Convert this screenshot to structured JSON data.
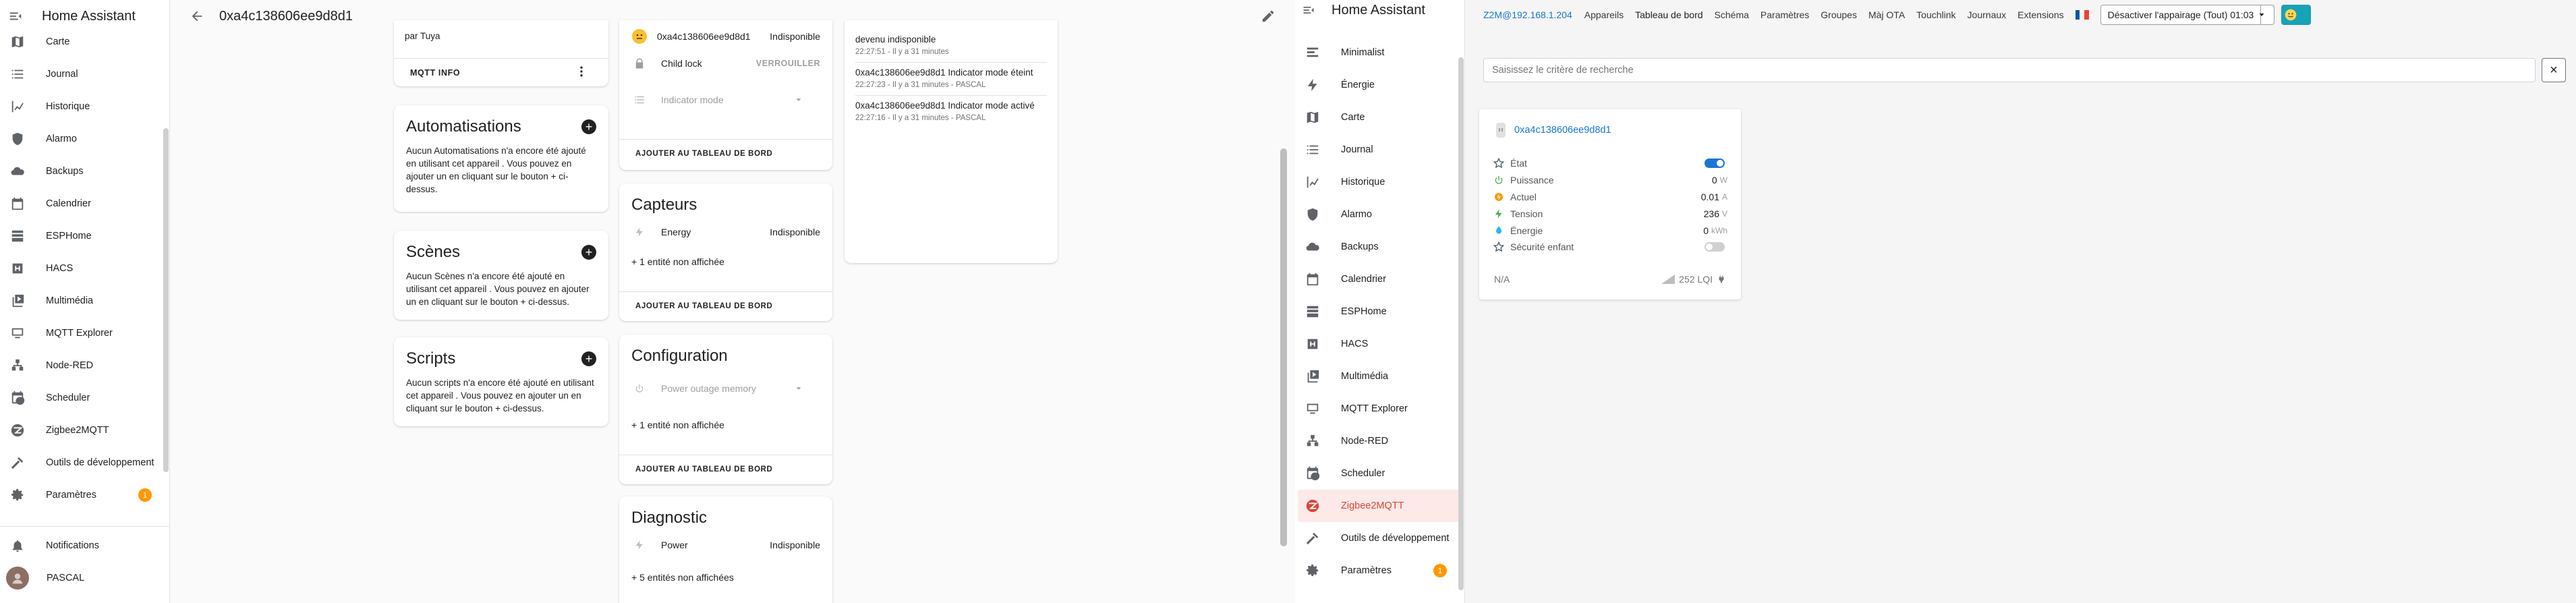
{
  "left": {
    "sidebar": {
      "title": "Home Assistant",
      "items": [
        {
          "label": "Carte",
          "icon": "map-icon"
        },
        {
          "label": "Journal",
          "icon": "journal-icon"
        },
        {
          "label": "Historique",
          "icon": "chart-icon"
        },
        {
          "label": "Alarmo",
          "icon": "shield-icon"
        },
        {
          "label": "Backups",
          "icon": "cloud-icon"
        },
        {
          "label": "Calendrier",
          "icon": "calendar-icon"
        },
        {
          "label": "ESPHome",
          "icon": "esphome-icon"
        },
        {
          "label": "HACS",
          "icon": "hacs-icon"
        },
        {
          "label": "Multimédia",
          "icon": "media-icon"
        },
        {
          "label": "MQTT Explorer",
          "icon": "mqtt-icon"
        },
        {
          "label": "Node-RED",
          "icon": "sitemap-icon"
        },
        {
          "label": "Scheduler",
          "icon": "calendar-clock-icon"
        },
        {
          "label": "Zigbee2MQTT",
          "icon": "zigbee-icon"
        },
        {
          "label": "Outils de développement",
          "icon": "hammer-icon"
        },
        {
          "label": "Paramètres",
          "icon": "gear-icon",
          "badge": "1"
        }
      ],
      "notifications": "Notifications",
      "user": "PASCAL"
    },
    "topbar": {
      "title": "0xa4c138606ee9d8d1"
    },
    "mqtt_card": {
      "text": "par Tuya",
      "button": "MQTT INFO"
    },
    "automations": {
      "title": "Automatisations",
      "text": "Aucun Automatisations n'a encore été ajouté en utilisant cet appareil . Vous pouvez en ajouter un en cliquant sur le bouton + ci-dessus."
    },
    "scenes": {
      "title": "Scènes",
      "text": "Aucun Scènes n'a encore été ajouté en utilisant cet appareil . Vous pouvez en ajouter un en cliquant sur le bouton + ci-dessus."
    },
    "scripts": {
      "title": "Scripts",
      "text": "Aucun scripts n'a encore été ajouté en utilisant cet appareil . Vous pouvez en ajouter un en cliquant sur le bouton + ci-dessus."
    },
    "controls": {
      "device_name": "0xa4c138606ee9d8d1",
      "device_state": "Indisponible",
      "child_lock": "Child lock",
      "child_lock_btn": "VERROUILLER",
      "indicator": "Indicator mode",
      "add_btn": "AJOUTER AU TABLEAU DE BORD"
    },
    "capteurs": {
      "title": "Capteurs",
      "entity": "Energy",
      "state": "Indisponible",
      "hidden": "+ 1 entité non affichée",
      "add_btn": "AJOUTER AU TABLEAU DE BORD"
    },
    "configuration": {
      "title": "Configuration",
      "entity": "Power outage memory",
      "hidden": "+ 1 entité non affichée",
      "add_btn": "AJOUTER AU TABLEAU DE BORD"
    },
    "diagnostic": {
      "title": "Diagnostic",
      "entity": "Power",
      "state": "Indisponible",
      "hidden": "+ 5 entités non affichées"
    },
    "logbook": [
      {
        "text": "devenu indisponible",
        "sub": "22:27:51 - Il y a 31 minutes"
      },
      {
        "text": "0xa4c138606ee9d8d1 Indicator mode éteint",
        "sub": "22:27:23 - Il y a 31 minutes - PASCAL"
      },
      {
        "text": "0xa4c138606ee9d8d1 Indicator mode activé",
        "sub": "22:27:16 - Il y a 31 minutes - PASCAL"
      }
    ]
  },
  "right": {
    "sidebar": {
      "title": "Home Assistant",
      "items": [
        {
          "label": "Minimalist",
          "icon": "minimalist-icon"
        },
        {
          "label": "Énergie",
          "icon": "lightning-icon"
        },
        {
          "label": "Carte",
          "icon": "map-icon"
        },
        {
          "label": "Journal",
          "icon": "journal-icon"
        },
        {
          "label": "Historique",
          "icon": "chart-icon"
        },
        {
          "label": "Alarmo",
          "icon": "shield-icon"
        },
        {
          "label": "Backups",
          "icon": "cloud-icon"
        },
        {
          "label": "Calendrier",
          "icon": "calendar-icon"
        },
        {
          "label": "ESPHome",
          "icon": "esphome-icon"
        },
        {
          "label": "HACS",
          "icon": "hacs-icon"
        },
        {
          "label": "Multimédia",
          "icon": "media-icon"
        },
        {
          "label": "MQTT Explorer",
          "icon": "mqtt-icon"
        },
        {
          "label": "Node-RED",
          "icon": "sitemap-icon"
        },
        {
          "label": "Scheduler",
          "icon": "calendar-clock-icon"
        },
        {
          "label": "Zigbee2MQTT",
          "icon": "zigbee-icon",
          "active": true
        },
        {
          "label": "Outils de développement",
          "icon": "hammer-icon"
        },
        {
          "label": "Paramètres",
          "icon": "gear-icon",
          "badge": "1"
        }
      ]
    },
    "z2m": {
      "nav": {
        "host": "Z2M@192.168.1.204",
        "items": [
          "Appareils",
          "Tableau de bord",
          "Schéma",
          "Paramètres",
          "Groupes",
          "Màj OTA",
          "Touchlink",
          "Journaux",
          "Extensions"
        ],
        "current": "Tableau de bord",
        "permit_join": "Désactiver l'appairage (Tout) 01:03"
      },
      "search_placeholder": "Saisissez le critère de recherche",
      "device": {
        "name": "0xa4c138606ee9d8d1",
        "rows": [
          {
            "label": "État",
            "icon": "star-icon",
            "type": "toggle",
            "on": true
          },
          {
            "label": "Puissance",
            "icon": "power-icon",
            "value": "0",
            "unit": "W"
          },
          {
            "label": "Actuel",
            "icon": "current-icon",
            "value": "0.01",
            "unit": "A"
          },
          {
            "label": "Tension",
            "icon": "voltage-icon",
            "value": "236",
            "unit": "V"
          },
          {
            "label": "Énergie",
            "icon": "energy-icon",
            "value": "0",
            "unit": "kWh"
          },
          {
            "label": "Sécurité enfant",
            "icon": "star-icon",
            "type": "toggle",
            "on": false
          }
        ],
        "footer_left": "N/A",
        "lqi": "252 LQI"
      }
    }
  }
}
